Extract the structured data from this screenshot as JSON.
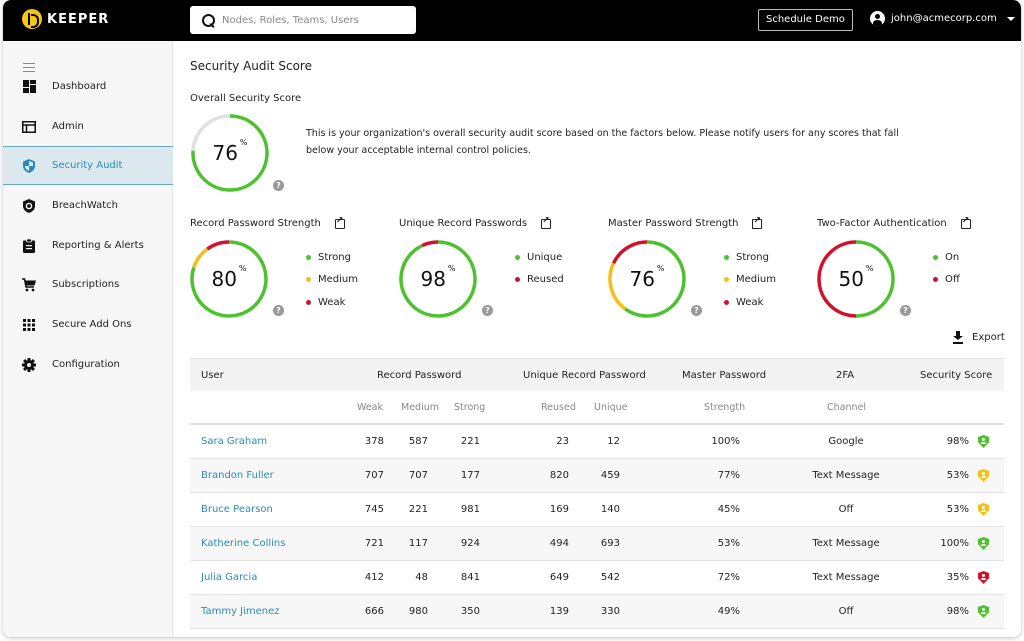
{
  "brand": {
    "name": "KEEPER"
  },
  "topbar": {
    "search_placeholder": "Nodes, Roles, Teams, Users",
    "schedule_demo": "Schedule Demo",
    "user_email": "john@acmecorp.com"
  },
  "sidebar": {
    "items": [
      {
        "label": "Dashboard",
        "icon": "dashboard-icon"
      },
      {
        "label": "Admin",
        "icon": "admin-icon"
      },
      {
        "label": "Security Audit",
        "icon": "shield-icon",
        "active": true
      },
      {
        "label": "BreachWatch",
        "icon": "breachwatch-icon"
      },
      {
        "label": "Reporting & Alerts",
        "icon": "clipboard-icon"
      },
      {
        "label": "Subscriptions",
        "icon": "cart-icon"
      },
      {
        "label": "Secure Add Ons",
        "icon": "grid-icon"
      },
      {
        "label": "Configuration",
        "icon": "gear-icon"
      }
    ]
  },
  "colors": {
    "green": "#4cc22f",
    "yellow": "#f5bf13",
    "red": "#d0132b",
    "track": "#e0e0e0",
    "link": "#2a8bb8"
  },
  "main": {
    "title": "Security Audit Score",
    "overall": {
      "label": "Overall Security Score",
      "value": "76",
      "unit": "%",
      "percent": 76,
      "description": "This is your organization's overall security audit score based on the factors below. Please notify users for any scores that fall below your acceptable internal control policies."
    },
    "cards": [
      {
        "title": "Record Password Strength",
        "value": "80",
        "unit": "%",
        "segments": [
          {
            "label": "Strong",
            "color": "#4cc22f",
            "share": 80
          },
          {
            "label": "Medium",
            "color": "#f5bf13",
            "share": 10
          },
          {
            "label": "Weak",
            "color": "#d0132b",
            "share": 10
          }
        ],
        "legend": [
          "Strong",
          "Medium",
          "Weak"
        ]
      },
      {
        "title": "Unique Record Passwords",
        "value": "98",
        "unit": "%",
        "segments": [
          {
            "label": "Unique",
            "color": "#4cc22f",
            "share": 93
          },
          {
            "label": "Reused",
            "color": "#d0132b",
            "share": 7
          }
        ],
        "legend": [
          "Unique",
          "Reused"
        ]
      },
      {
        "title": "Master Password Strength",
        "value": "76",
        "unit": "%",
        "segments": [
          {
            "label": "Strong",
            "color": "#4cc22f",
            "share": 60
          },
          {
            "label": "Medium",
            "color": "#f5bf13",
            "share": 22
          },
          {
            "label": "Weak",
            "color": "#d0132b",
            "share": 18
          }
        ],
        "legend": [
          "Strong",
          "Medium",
          "Weak"
        ]
      },
      {
        "title": "Two-Factor Authentication",
        "value": "50",
        "unit": "%",
        "segments": [
          {
            "label": "On",
            "color": "#4cc22f",
            "share": 50
          },
          {
            "label": "Off",
            "color": "#d0132b",
            "share": 50
          }
        ],
        "legend": [
          "On",
          "Off"
        ]
      }
    ],
    "export_label": "Export",
    "table": {
      "headers": [
        "User",
        "Record Password",
        "Unique Record Password",
        "Master Password",
        "2FA",
        "Security Score"
      ],
      "subheaders": [
        "Weak",
        "Medium",
        "Strong",
        "Reused",
        "Unique",
        "Strength",
        "Channel"
      ],
      "rows": [
        {
          "user": "Sara Graham",
          "weak": "378",
          "medium": "587",
          "strong": "221",
          "reused": "23",
          "unique": "12",
          "strength": "100%",
          "channel": "Google",
          "score": "98%",
          "status": "good"
        },
        {
          "user": "Brandon Fuller",
          "weak": "707",
          "medium": "707",
          "strong": "177",
          "reused": "820",
          "unique": "459",
          "strength": "77%",
          "channel": "Text Message",
          "score": "53%",
          "status": "warn"
        },
        {
          "user": "Bruce Pearson",
          "weak": "745",
          "medium": "221",
          "strong": "981",
          "reused": "169",
          "unique": "140",
          "strength": "45%",
          "channel": "Off",
          "score": "53%",
          "status": "warn"
        },
        {
          "user": "Katherine Collins",
          "weak": "721",
          "medium": "117",
          "strong": "924",
          "reused": "494",
          "unique": "693",
          "strength": "53%",
          "channel": "Text Message",
          "score": "100%",
          "status": "good"
        },
        {
          "user": "Julia Garcia",
          "weak": "412",
          "medium": "48",
          "strong": "841",
          "reused": "649",
          "unique": "542",
          "strength": "72%",
          "channel": "Text Message",
          "score": "35%",
          "status": "bad"
        },
        {
          "user": "Tammy Jimenez",
          "weak": "666",
          "medium": "980",
          "strong": "350",
          "reused": "139",
          "unique": "330",
          "strength": "49%",
          "channel": "Off",
          "score": "98%",
          "status": "good"
        }
      ]
    }
  }
}
